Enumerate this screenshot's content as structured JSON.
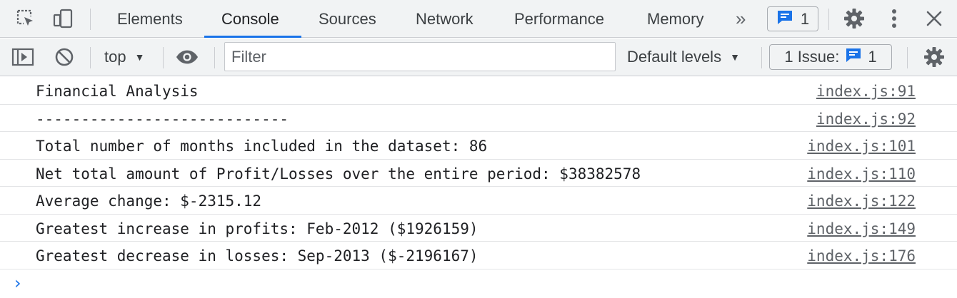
{
  "tabs": [
    {
      "label": "Elements",
      "active": false
    },
    {
      "label": "Console",
      "active": true
    },
    {
      "label": "Sources",
      "active": false
    },
    {
      "label": "Network",
      "active": false
    },
    {
      "label": "Performance",
      "active": false
    },
    {
      "label": "Memory",
      "active": false
    }
  ],
  "tabbar": {
    "more_tabs": "»",
    "issue_count": "1",
    "icons": [
      "inspect-element-icon",
      "device-toolbar-icon",
      "settings-gear-icon",
      "more-options-icon",
      "close-icon"
    ]
  },
  "toolbar": {
    "context": "top",
    "filter_placeholder": "Filter",
    "filter_value": "",
    "levels": "Default levels",
    "issues_label": "1 Issue:",
    "issues_count": "1",
    "icons": [
      "sidebar-toggle-icon",
      "clear-console-icon",
      "live-expression-eye-icon",
      "console-settings-gear-icon"
    ]
  },
  "console": {
    "rows": [
      {
        "text": "Financial Analysis",
        "source": "index.js:91"
      },
      {
        "text": "----------------------------",
        "source": "index.js:92"
      },
      {
        "text": "Total number of months included in the dataset: 86",
        "source": "index.js:101"
      },
      {
        "text": "Net total amount of Profit/Losses over the entire period: $38382578",
        "source": "index.js:110"
      },
      {
        "text": "Average change: $-2315.12",
        "source": "index.js:122"
      },
      {
        "text": "Greatest increase in profits: Feb-2012 ($1926159)",
        "source": "index.js:149"
      },
      {
        "text": "Greatest decrease in losses: Sep-2013 ($-2196167)",
        "source": "index.js:176"
      }
    ],
    "prompt": "›"
  },
  "colors": {
    "accent": "#1a73e8",
    "toolbar_bg": "#f1f3f4",
    "text": "#202124",
    "muted": "#5f6368"
  }
}
